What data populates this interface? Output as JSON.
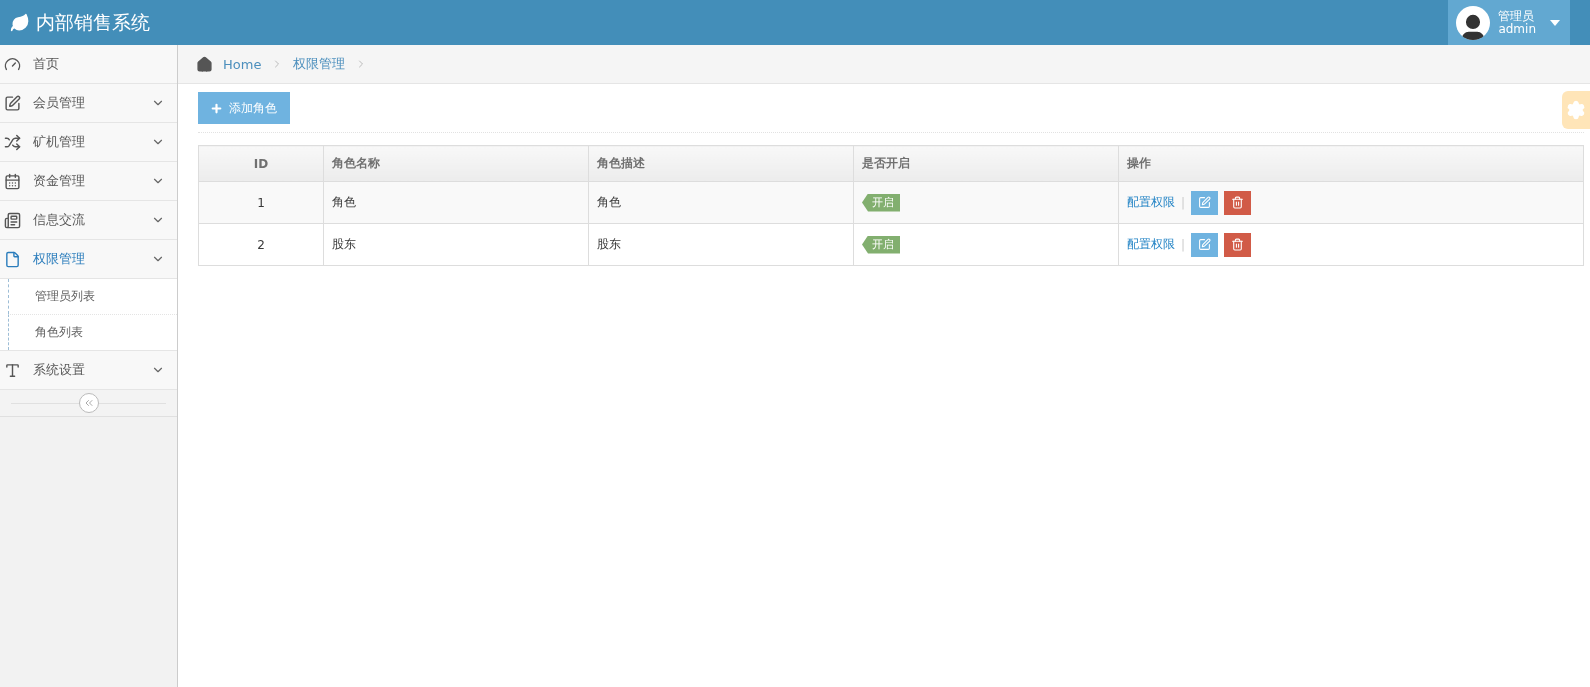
{
  "header": {
    "title": "内部销售系统",
    "user": {
      "role": "管理员",
      "name": "admin"
    }
  },
  "sidebar": {
    "items": [
      {
        "label": "首页",
        "kind": "link",
        "selected": false
      },
      {
        "label": "会员管理",
        "kind": "menu",
        "selected": false
      },
      {
        "label": "矿机管理",
        "kind": "menu",
        "selected": false
      },
      {
        "label": "资金管理",
        "kind": "menu",
        "selected": false
      },
      {
        "label": "信息交流",
        "kind": "menu",
        "selected": false
      },
      {
        "label": "权限管理",
        "kind": "menu",
        "selected": true,
        "children": [
          {
            "label": "管理员列表",
            "selected": false
          },
          {
            "label": "角色列表",
            "selected": false
          }
        ]
      },
      {
        "label": "系统设置",
        "kind": "menu",
        "selected": false
      }
    ]
  },
  "breadcrumb": [
    "Home",
    "权限管理"
  ],
  "add_button": "添加角色",
  "table": {
    "columns": [
      "ID",
      "角色名称",
      "角色描述",
      "是否开启",
      "操作"
    ],
    "rows": [
      {
        "id": "1",
        "name": "角色",
        "description": "角色",
        "status": {
          "label": "开启",
          "on": true
        },
        "action": "配置权限",
        "separator": "|"
      },
      {
        "id": "2",
        "name": "股东",
        "description": "股东",
        "status": {
          "label": "开启",
          "on": true
        },
        "action": "配置权限",
        "separator": "|"
      }
    ]
  }
}
